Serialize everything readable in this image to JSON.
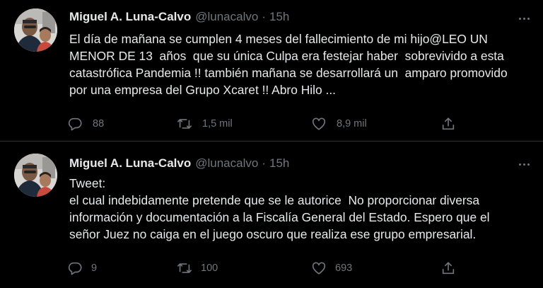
{
  "tweets": [
    {
      "author_name": "Miguel A. Luna-Calvo",
      "handle": "@lunacalvo",
      "separator": "·",
      "time": "15h",
      "text": "El día de mañana se cumplen 4 meses del fallecimiento de mi hijo@LEO UN MENOR DE 13  años  que su única Culpa era festejar haber  sobrevivido a esta catastrófica Pandemia !! también mañana se desarrollará un  amparo promovido por una empresa del Grupo Xcaret !! Abro Hilo ...",
      "replies": "88",
      "retweets": "1,5 mil",
      "likes": "8,9 mil"
    },
    {
      "author_name": "Miguel A. Luna-Calvo",
      "handle": "@lunacalvo",
      "separator": "·",
      "time": "15h",
      "text": "Tweet:\nel cual indebidamente pretende que se le autorice  No proporcionar diversa información y documentación a la Fiscalía General del Estado. Espero que el señor Juez no caiga en el juego oscuro que realiza ese grupo empresarial.",
      "replies": "9",
      "retweets": "100",
      "likes": "693"
    }
  ],
  "icons": {
    "reply": "reply-icon",
    "retweet": "retweet-icon",
    "like": "heart-icon",
    "share": "share-icon",
    "more": "more-icon"
  },
  "colors": {
    "background": "#000000",
    "text": "#e7e9ea",
    "muted": "#71767b",
    "divider": "#2f3336"
  }
}
